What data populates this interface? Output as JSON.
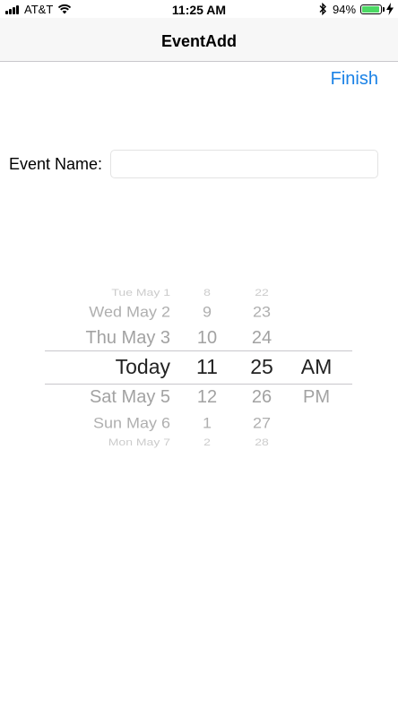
{
  "status_bar": {
    "carrier": "AT&T",
    "time": "11:25 AM",
    "battery_percent": "94%",
    "battery_level": 0.94,
    "battery_color": "#4cd964"
  },
  "nav": {
    "title": "EventAdd"
  },
  "actions": {
    "finish_label": "Finish",
    "accent_color": "#1a82e6"
  },
  "form": {
    "event_name_label": "Event Name:",
    "event_name_value": "",
    "event_name_placeholder": ""
  },
  "picker": {
    "dates": [
      "Tue May 1",
      "Wed May 2",
      "Thu May 3",
      "Today",
      "Sat May 5",
      "Sun May 6",
      "Mon May 7"
    ],
    "hours": [
      "8",
      "9",
      "10",
      "11",
      "12",
      "1",
      "2"
    ],
    "minutes": [
      "22",
      "23",
      "24",
      "25",
      "26",
      "27",
      "28"
    ],
    "ampm": [
      "AM",
      "PM"
    ],
    "selected": {
      "date": "Today",
      "hour": "11",
      "minute": "25",
      "ampm": "AM"
    }
  }
}
